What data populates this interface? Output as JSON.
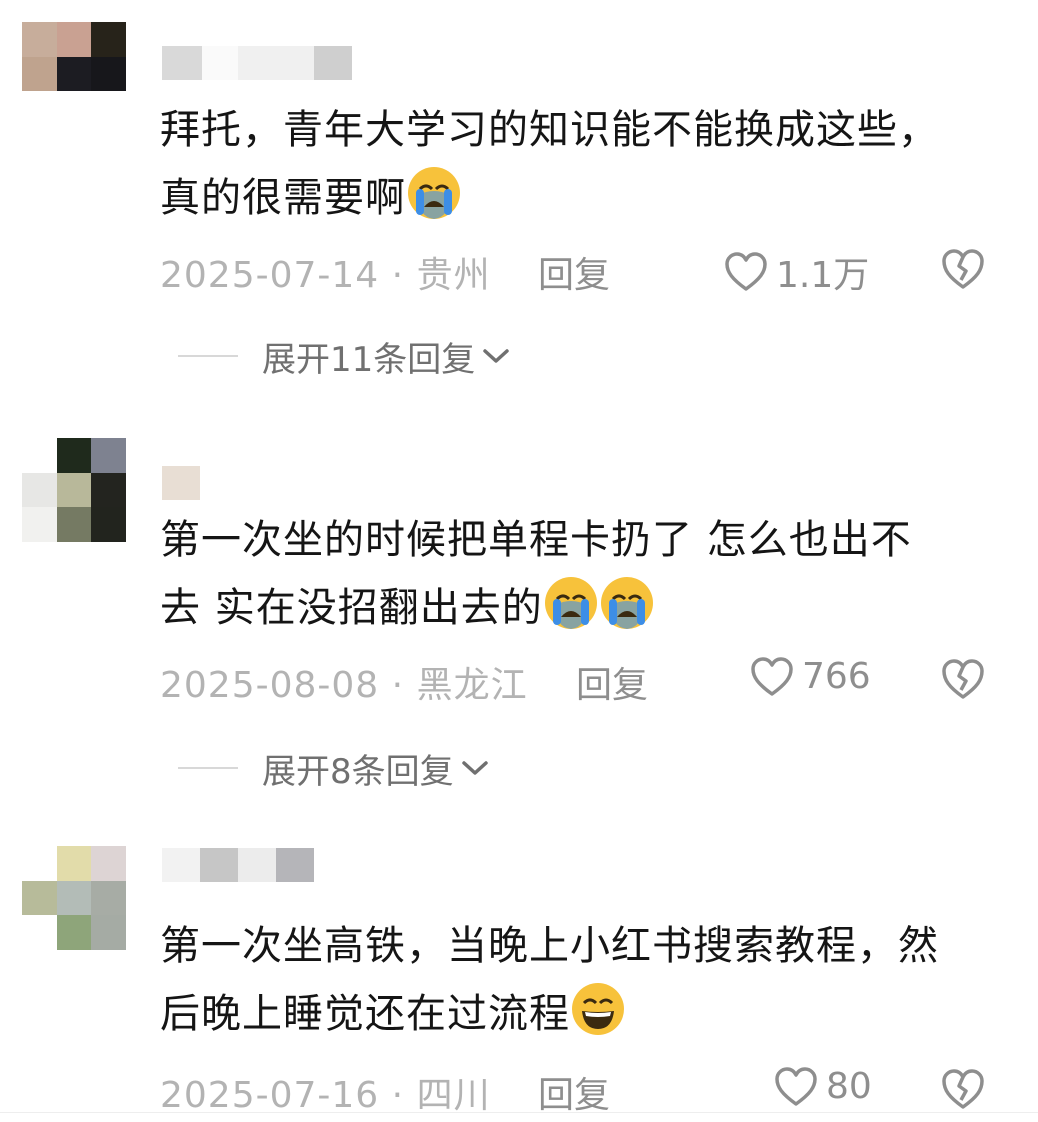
{
  "comments": [
    {
      "text_line1": "拜托，青年大学习的知识能不能换成这些，",
      "text_line2": "真的很需要啊",
      "emoji": [
        "crying-face"
      ],
      "date": "2025-07-14",
      "separator": "·",
      "location": "贵州",
      "reply_label": "回复",
      "likes": "1.1万",
      "expand_label": "展开11条回复"
    },
    {
      "text_line1": "第一次坐的时候把单程卡扔了 怎么也出不",
      "text_line2": "去 实在没招翻出去的",
      "emoji": [
        "crying-face",
        "crying-face"
      ],
      "date": "2025-08-08",
      "separator": "·",
      "location": "黑龙江",
      "reply_label": "回复",
      "likes": "766",
      "expand_label": "展开8条回复"
    },
    {
      "text_line1": "第一次坐高铁，当晚上小红书搜索教程，然",
      "text_line2": "后晚上睡觉还在过流程",
      "emoji": [
        "grinning-face"
      ],
      "date": "2025-07-16",
      "separator": "·",
      "location": "四川",
      "reply_label": "回复",
      "likes": "80"
    }
  ],
  "colors": {
    "text": "#151515",
    "meta": "#b3b3b3",
    "action": "#8e8e8e",
    "emoji_yellow": "#f7c23b",
    "emoji_tear": "#3d8ee6"
  }
}
